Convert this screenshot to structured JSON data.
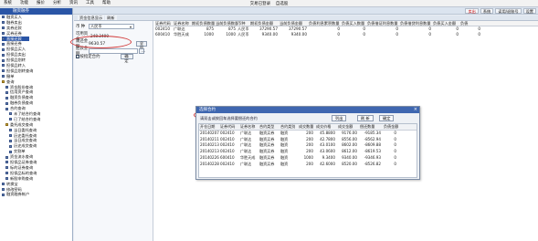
{
  "menu": [
    "系统",
    "功能",
    "报价",
    "分析",
    "资讯",
    "工具",
    "帮助"
  ],
  "window_title": "交易已登录",
  "window_subtitle": "自选股",
  "toolbar": {
    "buttons": [
      "卖出",
      "系统",
      "读用/退账号",
      "设置"
    ]
  },
  "sidebar": {
    "title": "融资融券",
    "items": [
      {
        "label": "融资买入"
      },
      {
        "label": "融券卖出"
      },
      {
        "label": "卖券还款"
      },
      {
        "label": "买券还券"
      },
      {
        "label": "直接还款"
      },
      {
        "label": "直接还券"
      },
      {
        "label": "担保品买入"
      },
      {
        "label": "担保品卖出"
      },
      {
        "label": "担保品划转"
      },
      {
        "label": "担保品转入"
      },
      {
        "label": "担保品划转查询"
      },
      {
        "label": "撤单"
      },
      {
        "label": "查询"
      },
      {
        "label": "资金股份查询"
      },
      {
        "label": "信用资产查询"
      },
      {
        "label": "融资负债查询"
      },
      {
        "label": "融券负债查询"
      },
      {
        "label": "合约查询"
      },
      {
        "label": "未了结合约查询"
      },
      {
        "label": "已了结合约查询"
      },
      {
        "label": "委托成交查询"
      },
      {
        "label": "当日委托查询"
      },
      {
        "label": "历史委托查询"
      },
      {
        "label": "当日成交查询"
      },
      {
        "label": "历史成交查询"
      },
      {
        "label": "交割单"
      },
      {
        "label": "资金流水查询"
      },
      {
        "label": "担保品证券查询"
      },
      {
        "label": "标的证券查询"
      },
      {
        "label": "担保品标的查询"
      },
      {
        "label": "新股申购查询"
      },
      {
        "label": "转换宝"
      },
      {
        "label": "修改密码"
      },
      {
        "label": "融资融券帐户"
      }
    ],
    "selected": "直接还款"
  },
  "tabs": [
    "资金信息显示",
    "刷新"
  ],
  "form": {
    "currency_label": "币 种",
    "currency_value": "人民币",
    "funds_label": "可用资金",
    "funds_value": "248.2400",
    "debt_label": "需还金额",
    "debt_value": "9630.57",
    "all_button": "全部",
    "repay_label": "还款金额",
    "repay_value": "",
    "dot_button": "...",
    "checkbox_label": "按指定合约",
    "checkbox_checked": true,
    "ok_button": "确定"
  },
  "main_grid": {
    "headers": [
      "证券代码",
      "证券名称",
      "期初负债数量",
      "当前负债数量",
      "币种",
      "期初负债金额",
      "当前负债金额",
      "负债利息累积数量",
      "负债买入数量",
      "负债借证利息数量",
      "负债借贷利息数量",
      "负债买入金额",
      "负债"
    ],
    "rows": [
      [
        "002410",
        "广联达",
        "875",
        "875",
        "人民币",
        "37290.57",
        "37290.57",
        "0",
        "0",
        "0",
        "0",
        "0",
        "0"
      ],
      [
        "600410",
        "华胜天成",
        "1000",
        "1000",
        "人民币",
        "9340.00",
        "9340.00",
        "0",
        "0",
        "0",
        "0",
        "0",
        "0"
      ]
    ]
  },
  "dialog": {
    "title": "选择合约",
    "prompt": "请双击或按回车选择要偿还的合约",
    "buttons": [
      "列出",
      "刷 新",
      "确定"
    ],
    "headers": [
      "开仓日期",
      "证券代码",
      "证券名称",
      "合约类型",
      "合约类别",
      "成交数量",
      "成交价格",
      "成交金额",
      "偿还数量",
      "负债金额"
    ],
    "rows": [
      [
        "20140207",
        "002410",
        "广联达",
        "融资买券",
        "融资",
        "200",
        "45.8800",
        "9176.00",
        "-9185.34",
        "0"
      ],
      [
        "20140211",
        "002410",
        "广联达",
        "融资买券",
        "融资",
        "200",
        "42.7800",
        "8556.00",
        "-8562.94",
        "0"
      ],
      [
        "20140213",
        "002410",
        "广联达",
        "融资买券",
        "融资",
        "200",
        "43.0100",
        "8602.00",
        "-8609.88",
        "0"
      ],
      [
        "20140213",
        "002410",
        "广联达",
        "融资买券",
        "融资",
        "200",
        "43.0600",
        "8612.00",
        "-8619.53",
        "0"
      ],
      [
        "20140226",
        "600410",
        "华胜天成",
        "融资买券",
        "融资",
        "1000",
        "9.3400",
        "9340.00",
        "-9346.93",
        "0"
      ],
      [
        "20140228",
        "002410",
        "广联达",
        "融资买券",
        "融资",
        "200",
        "42.6000",
        "8520.00",
        "-8526.82",
        "0"
      ]
    ]
  }
}
